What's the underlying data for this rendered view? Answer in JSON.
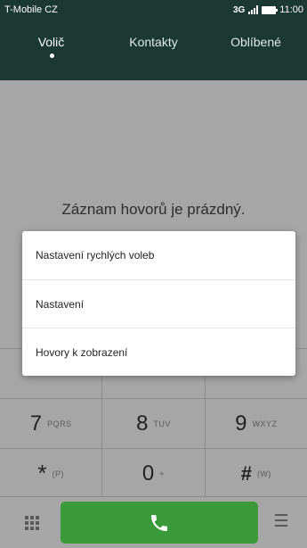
{
  "status": {
    "carrier": "T-Mobile CZ",
    "network": "3G",
    "time": "11:00"
  },
  "tabs": [
    {
      "label": "Volič",
      "active": true
    },
    {
      "label": "Kontakty",
      "active": false
    },
    {
      "label": "Oblíbené",
      "active": false
    }
  ],
  "call_log": {
    "empty_message": "Záznam hovorů je prázdný."
  },
  "keypad": {
    "rows": [
      [
        {
          "digit": "7",
          "letters": "PQRS"
        },
        {
          "digit": "8",
          "letters": "TUV"
        },
        {
          "digit": "9",
          "letters": "WXYZ"
        }
      ],
      [
        {
          "digit": "*",
          "letters": "(P)"
        },
        {
          "digit": "0",
          "letters": "+"
        },
        {
          "digit": "#",
          "letters": "(W)"
        }
      ]
    ]
  },
  "menu": {
    "items": [
      "Nastavení rychlých voleb",
      "Nastavení",
      "Hovory k zobrazení"
    ]
  },
  "icons": {
    "dialpad": "dialpad-grid-icon",
    "call": "phone-handset-icon",
    "menu": "hamburger-menu-icon"
  },
  "colors": {
    "header": "#1c3833",
    "call_button": "#3a9a3a",
    "background_dimmed": "#a6a6a6"
  }
}
